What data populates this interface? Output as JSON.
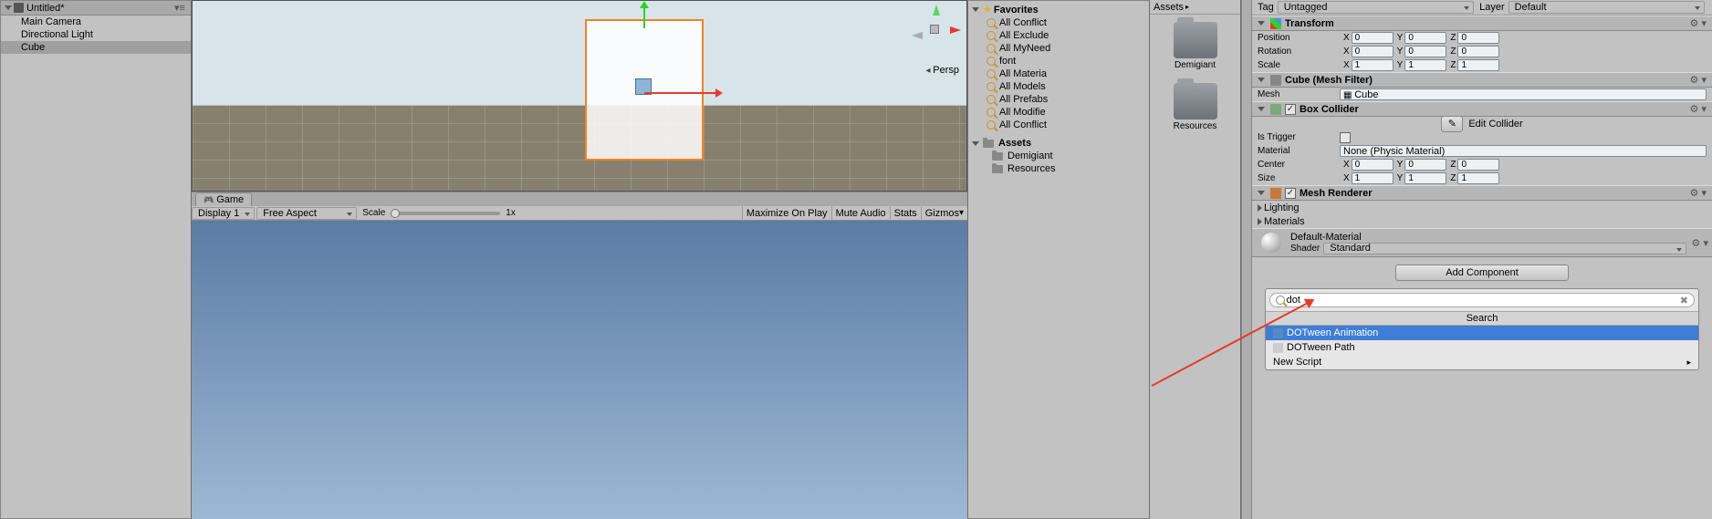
{
  "hierarchy": {
    "scene": "Untitled*",
    "items": [
      "Main Camera",
      "Directional Light",
      "Cube"
    ],
    "selected": 2
  },
  "game": {
    "tab": "Game",
    "display": "Display 1",
    "aspect": "Free Aspect",
    "scaleLabel": "Scale",
    "scaleVal": "1x",
    "buttons": [
      "Maximize On Play",
      "Mute Audio",
      "Stats",
      "Gizmos"
    ]
  },
  "scene": {
    "persp": "Persp"
  },
  "project": {
    "favLabel": "Favorites",
    "favorites": [
      "All Conflict",
      "All Exclude",
      "All MyNeed",
      "font",
      "All Materia",
      "All Models",
      "All Prefabs",
      "All Modifie",
      "All Conflict"
    ],
    "assetsLabel": "Assets",
    "folders": [
      "Demigiant",
      "Resources"
    ]
  },
  "assetsGrid": {
    "crumb": "Assets",
    "items": [
      "Demigiant",
      "Resources"
    ]
  },
  "inspector": {
    "tagLabel": "Tag",
    "tag": "Untagged",
    "layerLabel": "Layer",
    "layer": "Default",
    "transform": {
      "title": "Transform",
      "position": {
        "label": "Position",
        "x": "0",
        "y": "0",
        "z": "0"
      },
      "rotation": {
        "label": "Rotation",
        "x": "0",
        "y": "0",
        "z": "0"
      },
      "scale": {
        "label": "Scale",
        "x": "1",
        "y": "1",
        "z": "1"
      }
    },
    "meshFilter": {
      "title": "Cube (Mesh Filter)",
      "meshLabel": "Mesh",
      "mesh": "Cube"
    },
    "boxCollider": {
      "title": "Box Collider",
      "editBtn": "Edit Collider",
      "trigger": "Is Trigger",
      "materialLabel": "Material",
      "material": "None (Physic Material)",
      "center": {
        "label": "Center",
        "x": "0",
        "y": "0",
        "z": "0"
      },
      "size": {
        "label": "Size",
        "x": "1",
        "y": "1",
        "z": "1"
      }
    },
    "meshRenderer": {
      "title": "Mesh Renderer",
      "lighting": "Lighting",
      "materials": "Materials"
    },
    "material": {
      "name": "Default-Material",
      "shaderLabel": "Shader",
      "shader": "Standard"
    },
    "addBtn": "Add Component",
    "search": {
      "query": "dot",
      "header": "Search",
      "items": [
        "DOTween Animation",
        "DOTween Path",
        "New Script"
      ],
      "selected": 0
    }
  }
}
